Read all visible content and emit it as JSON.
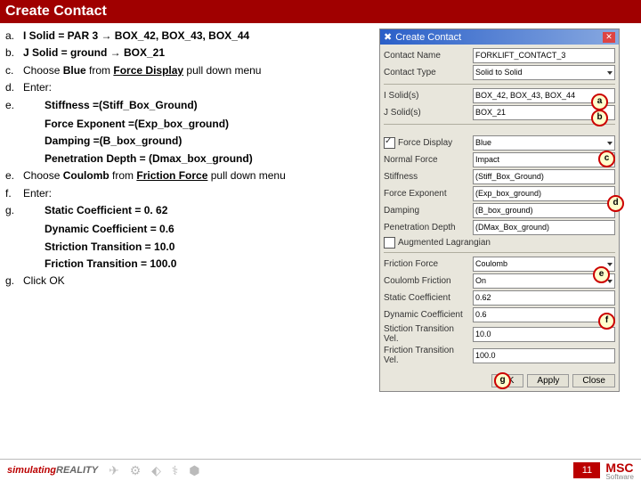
{
  "title": "Create Contact",
  "steps": {
    "a": {
      "lbl": "a.",
      "html": "<b>I Solid = PAR 3 → BOX_42, BOX_43, BOX_44</b>"
    },
    "b": {
      "lbl": "b.",
      "html": "<b>J Solid = ground → BOX_21</b>"
    },
    "c": {
      "lbl": "c.",
      "html": "Choose <b>Blue</b> from <b><u>Force Display</u></b> pull down menu"
    },
    "d": {
      "lbl": "d.",
      "html": "Enter:"
    },
    "e1": {
      "lbl": "e.",
      "html": ""
    },
    "sub1": "Stiffness =(Stiff_Box_Ground)",
    "sub2": "Force Exponent =(Exp_box_ground)",
    "sub3": "Damping =(B_box_ground)",
    "sub4": "Penetration Depth = (Dmax_box_ground)",
    "e2": {
      "lbl": "e.",
      "html": "Choose <b>Coulomb</b> from <b><u>Friction Force</u></b> pull down menu"
    },
    "f": {
      "lbl": "f.",
      "html": "Enter:"
    },
    "g1": {
      "lbl": "g.",
      "html": ""
    },
    "sub5": "Static Coefficient = 0. 62",
    "sub6": "Dynamic Coefficient = 0.6",
    "sub7": "Striction Transition = 10.0",
    "sub8": "Friction Transition = 100.0",
    "g2": {
      "lbl": "g.",
      "html": "Click OK"
    }
  },
  "panel": {
    "title": "Create Contact",
    "fields": {
      "contact_name": {
        "label": "Contact Name",
        "value": "FORKLIFT_CONTACT_3"
      },
      "contact_type": {
        "label": "Contact Type",
        "value": "Solid to Solid"
      },
      "isolid": {
        "label": "I Solid(s)",
        "value": "BOX_42, BOX_43, BOX_44"
      },
      "jsolid": {
        "label": "J Solid(s)",
        "value": "BOX_21"
      },
      "force_display": {
        "label": "Force Display",
        "value": "Blue",
        "checked": true
      },
      "normal_force": {
        "label": "Normal Force",
        "value": "Impact"
      },
      "stiffness": {
        "label": "Stiffness",
        "value": "(Stiff_Box_Ground)"
      },
      "force_exponent": {
        "label": "Force Exponent",
        "value": "(Exp_box_ground)"
      },
      "damping": {
        "label": "Damping",
        "value": "(B_box_ground)"
      },
      "pen_depth": {
        "label": "Penetration Depth",
        "value": "(DMax_Box_ground)"
      },
      "aug_lag": {
        "label": "Augmented Lagrangian",
        "checked": false
      },
      "friction_force": {
        "label": "Friction Force",
        "value": "Coulomb"
      },
      "coulomb_friction": {
        "label": "Coulomb Friction",
        "value": "On"
      },
      "static_coef": {
        "label": "Static Coefficient",
        "value": "0.62"
      },
      "dynamic_coef": {
        "label": "Dynamic Coefficient",
        "value": "0.6"
      },
      "stiction_vel": {
        "label": "Stiction Transition Vel.",
        "value": "10.0"
      },
      "friction_vel": {
        "label": "Friction Transition Vel.",
        "value": "100.0"
      }
    },
    "buttons": {
      "ok": "OK",
      "apply": "Apply",
      "close": "Close"
    }
  },
  "callouts": {
    "a": "a",
    "b": "b",
    "c": "c",
    "d": "d",
    "e": "e",
    "f": "f",
    "g": "g"
  },
  "footer": {
    "sim": "simulating",
    "real": "REALITY",
    "page": "11",
    "brand": "MSC",
    "brand_sub": "Software"
  }
}
